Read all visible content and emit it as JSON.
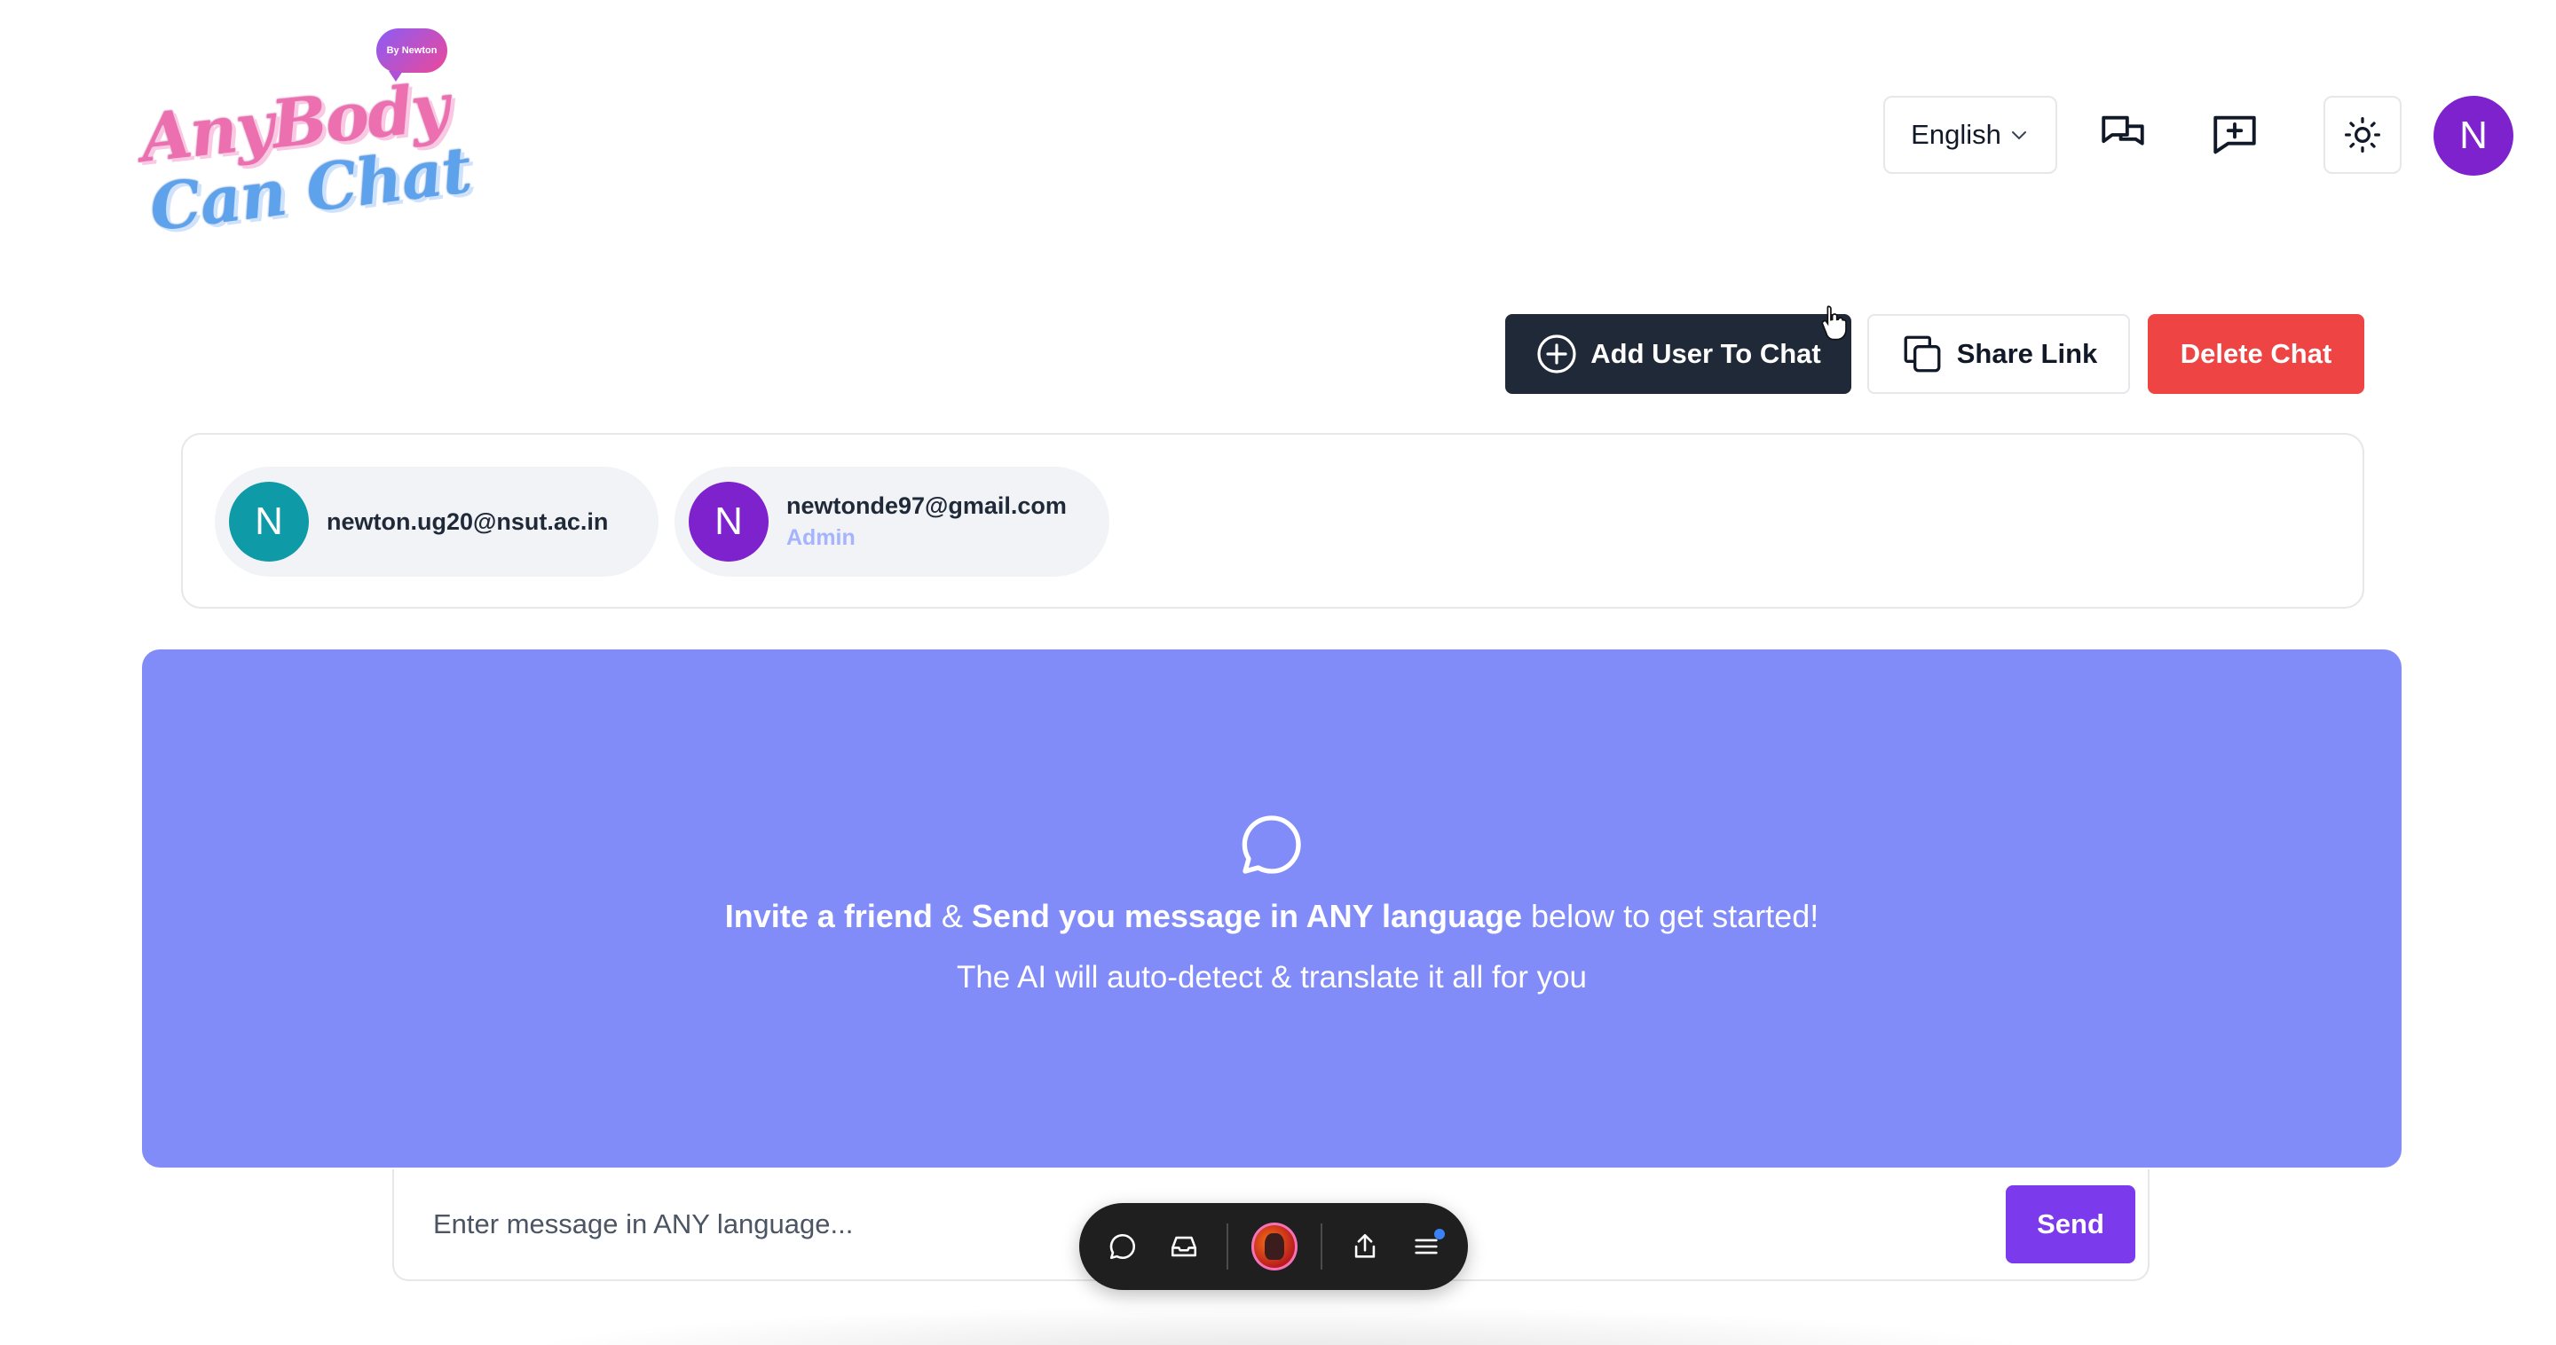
{
  "header": {
    "logo": {
      "line1": "AnyBody",
      "line2": "Can Chat",
      "badge": "By Newton"
    },
    "language": "English",
    "icons": [
      "chats-icon",
      "new-chat-icon",
      "theme-sun-icon"
    ],
    "user_avatar_initial": "N"
  },
  "actions": {
    "add_user_label": "Add User To Chat",
    "share_label": "Share Link",
    "delete_label": "Delete Chat"
  },
  "members": [
    {
      "initial": "N",
      "email": "newton.ug20@nsut.ac.in",
      "role": "",
      "color": "#0e9aa7"
    },
    {
      "initial": "N",
      "email": "newtonde97@gmail.com",
      "role": "Admin",
      "color": "#7e22ce"
    }
  ],
  "empty_state": {
    "part1": "Invite a friend",
    "amp": " & ",
    "part2": "Send you message in ANY language",
    "part3": " below to get started!",
    "subtitle": "The AI will auto-detect & translate it all for you"
  },
  "composer": {
    "placeholder": "Enter message in ANY language...",
    "send_label": "Send"
  },
  "colors": {
    "panel": "#818cf8",
    "send": "#7c3aed",
    "delete": "#ef4444",
    "add_user": "#1f2937"
  }
}
